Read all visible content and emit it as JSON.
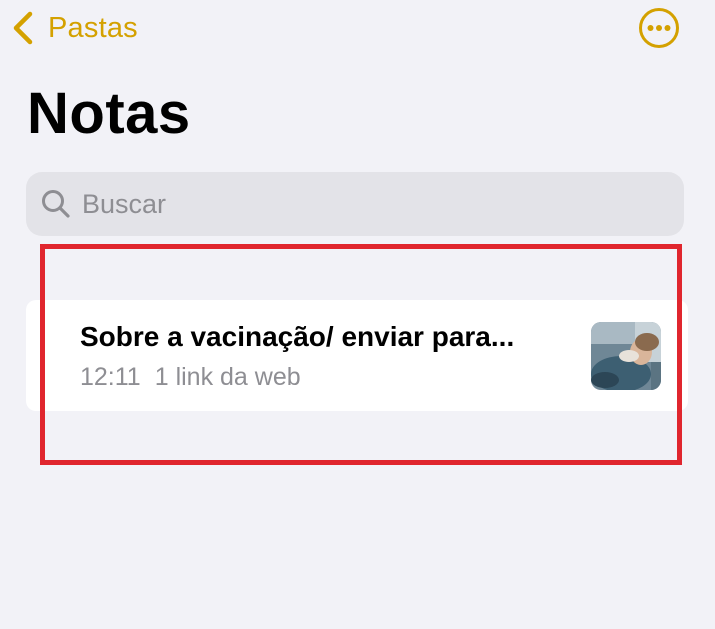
{
  "nav": {
    "back_label": "Pastas",
    "back_icon": "chevron-left-icon",
    "more_icon": "ellipsis-circle-icon"
  },
  "page": {
    "title": "Notas"
  },
  "search": {
    "placeholder": "Buscar",
    "value": "",
    "icon": "search-icon"
  },
  "notes": [
    {
      "title": "Sobre a vacinação/ enviar para...",
      "time": "12:11",
      "detail": "1 link da web",
      "thumbnail": "note-thumbnail-photo"
    }
  ],
  "colors": {
    "accent": "#d4a100",
    "background": "#f2f2f7",
    "search_bg": "#e3e3e8",
    "card_bg": "#ffffff",
    "secondary_text": "#8e8e93",
    "highlight": "#e0262e"
  }
}
